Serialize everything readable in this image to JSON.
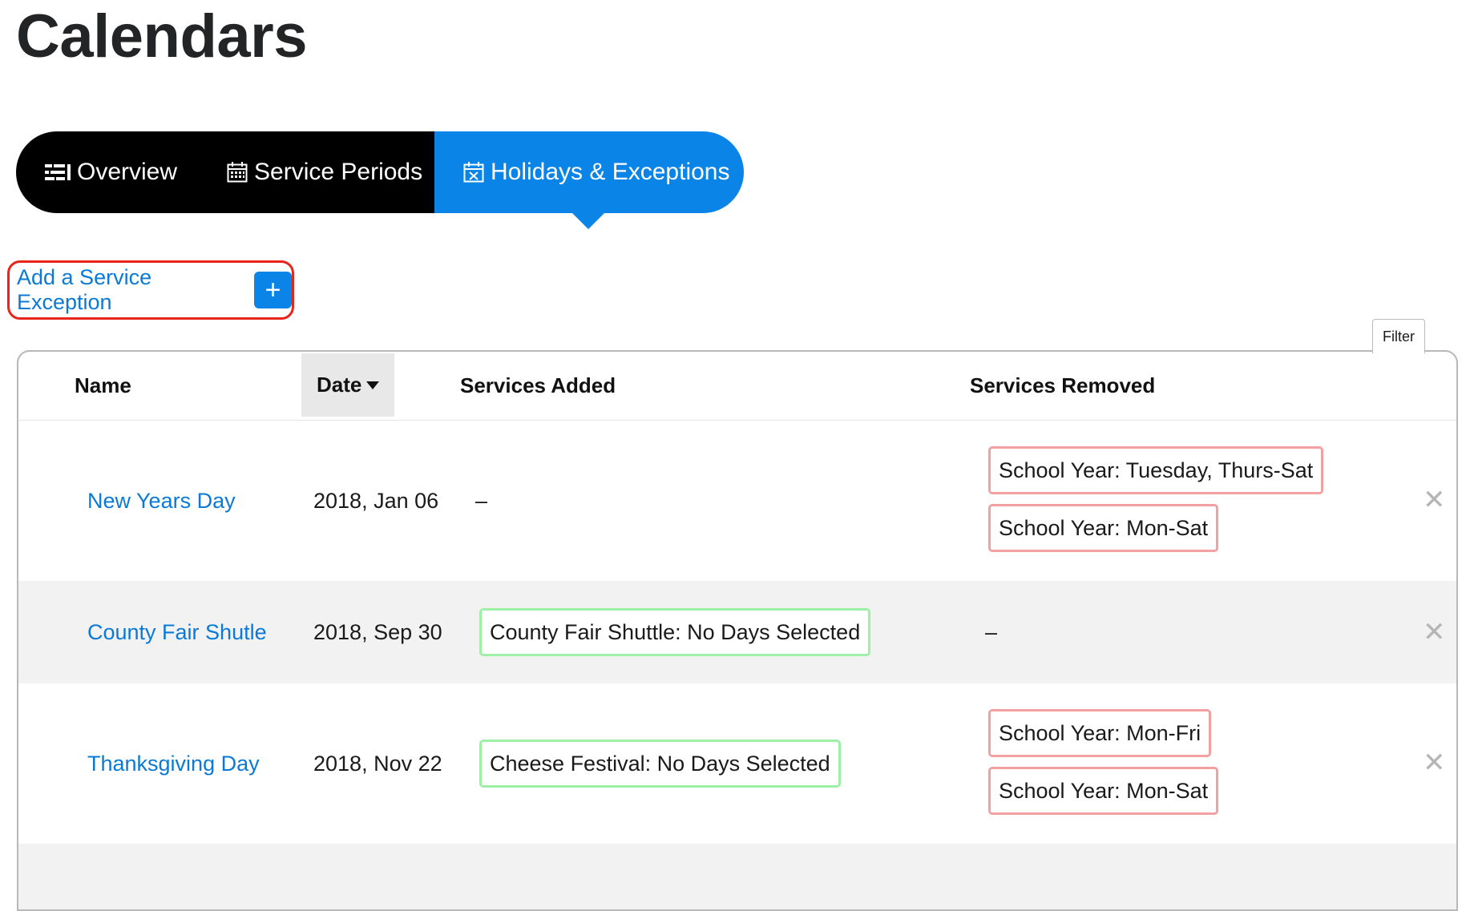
{
  "page": {
    "title": "Calendars"
  },
  "tabs": [
    {
      "label": "Overview",
      "icon": "list-icon"
    },
    {
      "label": "Service Periods",
      "icon": "calendar-icon"
    },
    {
      "label": "Holidays & Exceptions",
      "icon": "calendar-x-icon",
      "active": true
    }
  ],
  "add_exception": {
    "label": "Add a Service Exception",
    "button": "+"
  },
  "filter": {
    "label": "Filter"
  },
  "table": {
    "columns": [
      "Name",
      "Date",
      "Services Added",
      "Services Removed"
    ],
    "sorted_by": "Date",
    "sort_direction": "descending-caret",
    "rows": [
      {
        "name": "New Years Day",
        "date": "2018, Jan 06",
        "services_added": [],
        "services_added_empty": "–",
        "services_removed": [
          "School Year: Tuesday, Thurs-Sat",
          "School Year: Mon-Sat"
        ],
        "services_removed_empty": ""
      },
      {
        "name": "County Fair Shutle",
        "date": "2018, Sep 30",
        "services_added": [
          "County Fair Shuttle: No Days Selected"
        ],
        "services_added_empty": "",
        "services_removed": [],
        "services_removed_empty": "–"
      },
      {
        "name": "Thanksgiving Day",
        "date": "2018, Nov 22",
        "services_added": [
          "Cheese Festival: No Days Selected"
        ],
        "services_added_empty": "",
        "services_removed": [
          "School Year: Mon-Fri",
          "School Year: Mon-Sat"
        ],
        "services_removed_empty": ""
      }
    ],
    "delete_glyph": "✕"
  },
  "colors": {
    "accent_blue": "#0a84e6",
    "link_blue": "#0a7ad6",
    "highlight_red": "#e8251a",
    "added_border": "#9ef0a6",
    "removed_border": "#f2a0a0",
    "tab_dark": "#000000"
  }
}
